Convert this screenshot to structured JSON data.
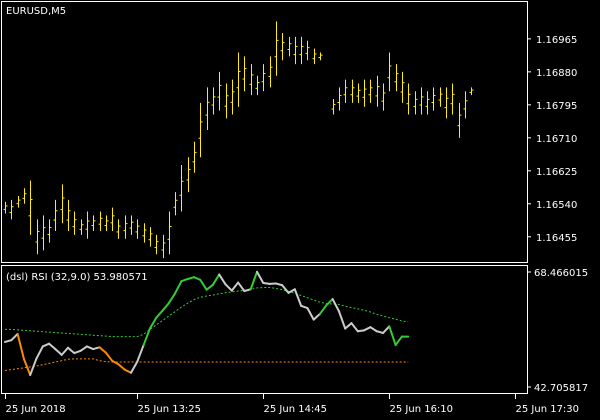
{
  "main_chart": {
    "symbol_label": "EURUSD,M5",
    "price_ticks": [
      "1.16965",
      "1.16880",
      "1.16795",
      "1.16710",
      "1.16625",
      "1.16540",
      "1.16455"
    ],
    "price_range": [
      1.1639,
      1.1706
    ],
    "bar_color": "#ffee00",
    "bars": [
      {
        "h": 1.16545,
        "l": 1.16515
      },
      {
        "h": 1.1655,
        "l": 1.165
      },
      {
        "h": 1.1656,
        "l": 1.1653
      },
      {
        "h": 1.1658,
        "l": 1.1654
      },
      {
        "h": 1.166,
        "l": 1.1646
      },
      {
        "h": 1.165,
        "l": 1.1641
      },
      {
        "h": 1.1651,
        "l": 1.1642
      },
      {
        "h": 1.165,
        "l": 1.1644
      },
      {
        "h": 1.1655,
        "l": 1.1647
      },
      {
        "h": 1.1659,
        "l": 1.1649
      },
      {
        "h": 1.1655,
        "l": 1.1647
      },
      {
        "h": 1.1652,
        "l": 1.1646
      },
      {
        "h": 1.165,
        "l": 1.1646
      },
      {
        "h": 1.1652,
        "l": 1.1645
      },
      {
        "h": 1.1651,
        "l": 1.1647
      },
      {
        "h": 1.1652,
        "l": 1.1647
      },
      {
        "h": 1.1651,
        "l": 1.1647
      },
      {
        "h": 1.1653,
        "l": 1.1647
      },
      {
        "h": 1.165,
        "l": 1.1645
      },
      {
        "h": 1.1651,
        "l": 1.1645
      },
      {
        "h": 1.1651,
        "l": 1.1646
      },
      {
        "h": 1.165,
        "l": 1.1645
      },
      {
        "h": 1.1649,
        "l": 1.1644
      },
      {
        "h": 1.1648,
        "l": 1.1643
      },
      {
        "h": 1.1646,
        "l": 1.1641
      },
      {
        "h": 1.1646,
        "l": 1.164
      },
      {
        "h": 1.1652,
        "l": 1.1641
      },
      {
        "h": 1.1657,
        "l": 1.1651
      },
      {
        "h": 1.1664,
        "l": 1.1652
      },
      {
        "h": 1.1666,
        "l": 1.1657
      },
      {
        "h": 1.167,
        "l": 1.1662
      },
      {
        "h": 1.168,
        "l": 1.1666
      },
      {
        "h": 1.1684,
        "l": 1.1673
      },
      {
        "h": 1.1684,
        "l": 1.1677
      },
      {
        "h": 1.1688,
        "l": 1.1678
      },
      {
        "h": 1.1685,
        "l": 1.1676
      },
      {
        "h": 1.1686,
        "l": 1.1677
      },
      {
        "h": 1.1693,
        "l": 1.1679
      },
      {
        "h": 1.1692,
        "l": 1.1683
      },
      {
        "h": 1.169,
        "l": 1.1682
      },
      {
        "h": 1.1687,
        "l": 1.1682
      },
      {
        "h": 1.169,
        "l": 1.1683
      },
      {
        "h": 1.1692,
        "l": 1.1684
      },
      {
        "h": 1.1701,
        "l": 1.1687
      },
      {
        "h": 1.1698,
        "l": 1.1691
      },
      {
        "h": 1.1697,
        "l": 1.1692
      },
      {
        "h": 1.1697,
        "l": 1.169
      },
      {
        "h": 1.1697,
        "l": 1.169
      },
      {
        "h": 1.1696,
        "l": 1.1691
      },
      {
        "h": 1.1694,
        "l": 1.169
      },
      {
        "h": 1.1693,
        "l": 1.1691
      },
      null,
      {
        "h": 1.1681,
        "l": 1.1677
      },
      {
        "h": 1.1684,
        "l": 1.1678
      },
      {
        "h": 1.1686,
        "l": 1.168
      },
      {
        "h": 1.1686,
        "l": 1.168
      },
      {
        "h": 1.1685,
        "l": 1.168
      },
      {
        "h": 1.1686,
        "l": 1.1679
      },
      {
        "h": 1.1686,
        "l": 1.168
      },
      {
        "h": 1.1687,
        "l": 1.1679
      },
      {
        "h": 1.1685,
        "l": 1.1678
      },
      {
        "h": 1.1693,
        "l": 1.1683
      },
      {
        "h": 1.169,
        "l": 1.1683
      },
      {
        "h": 1.1688,
        "l": 1.168
      },
      {
        "h": 1.1685,
        "l": 1.1677
      },
      {
        "h": 1.1683,
        "l": 1.1677
      },
      {
        "h": 1.1684,
        "l": 1.1677
      },
      {
        "h": 1.1683,
        "l": 1.1677
      },
      {
        "h": 1.1684,
        "l": 1.1678
      },
      {
        "h": 1.1684,
        "l": 1.1679
      },
      {
        "h": 1.1684,
        "l": 1.1676
      },
      {
        "h": 1.1685,
        "l": 1.1677
      },
      {
        "h": 1.168,
        "l": 1.1671
      },
      {
        "h": 1.1683,
        "l": 1.1676
      },
      {
        "h": 1.1684,
        "l": 1.1682
      }
    ]
  },
  "indicator": {
    "label": "(dsl) RSI (32,9.0) 53.980571",
    "ticks": [
      "68.466015",
      "42.705817"
    ],
    "range": [
      42.705817,
      68.466015
    ],
    "colors": {
      "neutral": "#cccccc",
      "up": "#33cc33",
      "down": "#ff8800"
    },
    "upper_level_color": "#33cc33",
    "lower_level_color": "#ff8800",
    "rsi": [
      {
        "v": 52.8,
        "c": "neutral"
      },
      {
        "v": 53.2,
        "c": "neutral"
      },
      {
        "v": 54.6,
        "c": "neutral"
      },
      {
        "v": 49.0,
        "c": "down"
      },
      {
        "v": 45.4,
        "c": "down"
      },
      {
        "v": 49.1,
        "c": "neutral"
      },
      {
        "v": 51.8,
        "c": "neutral"
      },
      {
        "v": 52.4,
        "c": "neutral"
      },
      {
        "v": 51.2,
        "c": "neutral"
      },
      {
        "v": 49.9,
        "c": "neutral"
      },
      {
        "v": 51.5,
        "c": "neutral"
      },
      {
        "v": 50.3,
        "c": "neutral"
      },
      {
        "v": 50.8,
        "c": "neutral"
      },
      {
        "v": 51.8,
        "c": "neutral"
      },
      {
        "v": 51.2,
        "c": "neutral"
      },
      {
        "v": 51.6,
        "c": "neutral"
      },
      {
        "v": 50.4,
        "c": "down"
      },
      {
        "v": 48.6,
        "c": "down"
      },
      {
        "v": 47.8,
        "c": "down"
      },
      {
        "v": 46.6,
        "c": "down"
      },
      {
        "v": 45.9,
        "c": "down"
      },
      {
        "v": 48.4,
        "c": "neutral"
      },
      {
        "v": 52.1,
        "c": "neutral"
      },
      {
        "v": 55.8,
        "c": "up"
      },
      {
        "v": 58.2,
        "c": "up"
      },
      {
        "v": 59.8,
        "c": "up"
      },
      {
        "v": 61.5,
        "c": "up"
      },
      {
        "v": 63.7,
        "c": "up"
      },
      {
        "v": 66.4,
        "c": "up"
      },
      {
        "v": 66.9,
        "c": "up"
      },
      {
        "v": 67.3,
        "c": "up"
      },
      {
        "v": 66.7,
        "c": "up"
      },
      {
        "v": 64.5,
        "c": "up"
      },
      {
        "v": 65.6,
        "c": "up"
      },
      {
        "v": 67.9,
        "c": "up"
      },
      {
        "v": 65.7,
        "c": "neutral"
      },
      {
        "v": 64.3,
        "c": "neutral"
      },
      {
        "v": 66.1,
        "c": "neutral"
      },
      {
        "v": 64.2,
        "c": "neutral"
      },
      {
        "v": 64.6,
        "c": "neutral"
      },
      {
        "v": 68.5,
        "c": "up"
      },
      {
        "v": 66.0,
        "c": "neutral"
      },
      {
        "v": 65.8,
        "c": "neutral"
      },
      {
        "v": 65.9,
        "c": "neutral"
      },
      {
        "v": 65.5,
        "c": "neutral"
      },
      {
        "v": 63.8,
        "c": "neutral"
      },
      {
        "v": 64.6,
        "c": "neutral"
      },
      {
        "v": 60.9,
        "c": "neutral"
      },
      {
        "v": 60.4,
        "c": "neutral"
      },
      {
        "v": 57.8,
        "c": "neutral"
      },
      {
        "v": 59.1,
        "c": "neutral"
      },
      {
        "v": 61.0,
        "c": "up"
      },
      {
        "v": 62.4,
        "c": "up"
      },
      {
        "v": 59.7,
        "c": "neutral"
      },
      {
        "v": 55.8,
        "c": "neutral"
      },
      {
        "v": 57.0,
        "c": "neutral"
      },
      {
        "v": 55.2,
        "c": "neutral"
      },
      {
        "v": 55.4,
        "c": "neutral"
      },
      {
        "v": 56.1,
        "c": "neutral"
      },
      {
        "v": 55.2,
        "c": "neutral"
      },
      {
        "v": 54.8,
        "c": "neutral"
      },
      {
        "v": 56.3,
        "c": "neutral"
      },
      {
        "v": 52.1,
        "c": "up"
      },
      {
        "v": 54.0,
        "c": "up"
      },
      {
        "v": 54.0,
        "c": "up"
      }
    ],
    "upper_level": [
      55.6,
      55.6,
      55.5,
      55.4,
      55.3,
      55.2,
      55.1,
      55.0,
      54.9,
      54.8,
      54.7,
      54.6,
      54.5,
      54.4,
      54.3,
      54.2,
      54.1,
      54.0,
      54.0,
      54.0,
      54.0,
      54.0,
      54.5,
      55.6,
      56.6,
      57.6,
      58.6,
      59.6,
      60.6,
      61.5,
      62.3,
      62.8,
      63.1,
      63.3,
      63.6,
      63.8,
      64.0,
      64.2,
      64.4,
      64.6,
      64.9,
      65.0,
      65.0,
      64.8,
      64.5,
      64.1,
      63.7,
      63.2,
      62.7,
      62.2,
      61.7,
      61.4,
      61.3,
      61.2,
      60.8,
      60.5,
      60.2,
      59.9,
      59.5,
      59.0,
      58.6,
      58.2,
      57.9,
      57.5,
      57.3
    ],
    "lower_level": [
      46.4,
      46.6,
      46.8,
      47.0,
      47.2,
      47.4,
      47.7,
      48.0,
      48.3,
      48.6,
      48.9,
      49.0,
      49.0,
      49.0,
      49.0,
      48.6,
      48.4,
      48.3,
      48.3,
      48.3,
      48.3,
      48.3,
      48.3,
      48.3,
      48.3,
      48.3,
      48.3,
      48.3,
      48.3,
      48.3,
      48.3,
      48.3,
      48.3,
      48.3,
      48.3,
      48.3,
      48.3,
      48.3,
      48.3,
      48.3,
      48.3,
      48.3,
      48.3,
      48.3,
      48.3,
      48.3,
      48.3,
      48.3,
      48.3,
      48.3,
      48.3,
      48.3,
      48.3,
      48.3,
      48.3,
      48.3,
      48.3,
      48.3,
      48.3,
      48.3,
      48.3,
      48.3,
      48.3,
      48.3,
      48.3
    ]
  },
  "time_axis": {
    "ticks": [
      {
        "label": "25 Jun 2018",
        "bar": 0
      },
      {
        "label": "25 Jun 13:25",
        "bar": 21
      },
      {
        "label": "25 Jun 14:45",
        "bar": 41
      },
      {
        "label": "25 Jun 16:10",
        "bar": 61
      },
      {
        "label": "25 Jun 17:30",
        "bar": 81
      }
    ]
  }
}
